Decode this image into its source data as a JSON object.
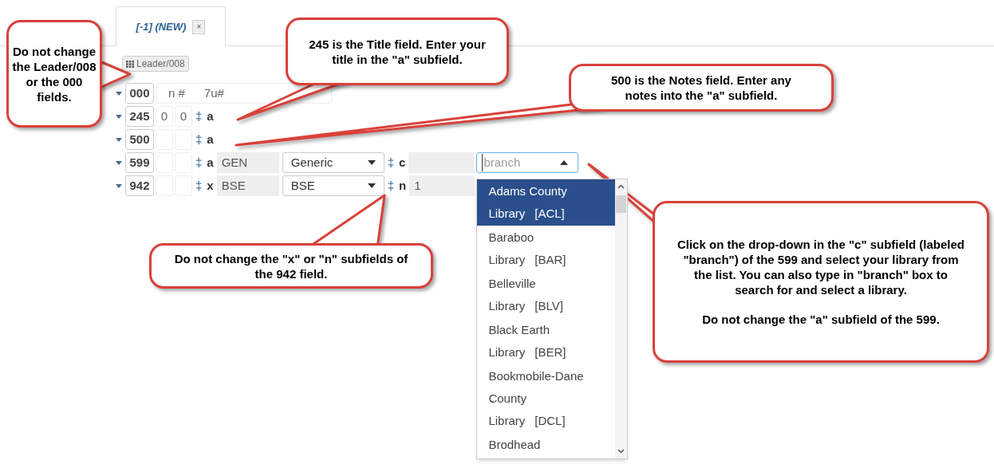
{
  "tab": {
    "label": "[-1] (NEW)",
    "close": "×",
    "selected": true
  },
  "leader_button": "Leader/008",
  "fields": [
    {
      "tag": "000",
      "kind": "control",
      "values": [
        "n #",
        "7u#"
      ]
    },
    {
      "tag": "245",
      "kind": "data",
      "ind1": "0",
      "ind2": "0",
      "subfields": [
        {
          "delimiter": "‡",
          "code": "a",
          "kind": "plain"
        }
      ]
    },
    {
      "tag": "500",
      "kind": "data",
      "subfields": [
        {
          "delimiter": "‡",
          "code": "a",
          "kind": "plain"
        }
      ]
    },
    {
      "tag": "599",
      "kind": "data",
      "subfields": [
        {
          "delimiter": "‡",
          "code": "a",
          "kind": "coded",
          "value": "GEN",
          "option": "Generic"
        },
        {
          "delimiter": "‡",
          "code": "c",
          "kind": "branch",
          "placeholder": "branch",
          "expanded": true
        }
      ]
    },
    {
      "tag": "942",
      "kind": "data",
      "subfields": [
        {
          "delimiter": "‡",
          "code": "x",
          "kind": "coded",
          "value": "BSE",
          "option": "BSE"
        },
        {
          "delimiter": "‡",
          "code": "n",
          "kind": "readonly",
          "value": "1"
        }
      ]
    }
  ],
  "branch_options": [
    {
      "name": "Adams County Library",
      "code": "[ACL]",
      "selected": true
    },
    {
      "name": "Baraboo Library",
      "code": "[BAR]",
      "selected": false
    },
    {
      "name": "Belleville Library",
      "code": "[BLV]",
      "selected": false
    },
    {
      "name": "Black Earth Library",
      "code": "[BER]",
      "selected": false
    },
    {
      "name": "Bookmobile-Dane County Library",
      "code": "[DCL]",
      "selected": false
    },
    {
      "name": "Brodhead",
      "selected": false
    }
  ],
  "callouts": [
    {
      "paragraphs": [
        "Do not change the Leader/008 or the 000 fields."
      ]
    },
    {
      "paragraphs": [
        "245 is the Title field. Enter your title in the \"a\" subfield."
      ]
    },
    {
      "paragraphs": [
        "500 is the Notes field. Enter any notes into the \"a\" subfield."
      ]
    },
    {
      "paragraphs": [
        "Do not change the \"x\" or \"n\" subfields of the 942 field."
      ]
    },
    {
      "paragraphs": [
        "Click on the drop-down in the \"c\" subfield (labeled \"branch\") of the 599 and select your library from the list. You can also type in \"branch\" box to search for and select a library.",
        "Do not change the \"a\" subfield of the 599."
      ]
    }
  ]
}
